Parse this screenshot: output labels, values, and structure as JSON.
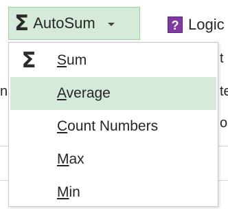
{
  "ribbon": {
    "autosum": {
      "icon": "sigma-icon",
      "glyph": "Σ",
      "label": "AutoSum",
      "caret": "dropdown-caret"
    },
    "logical": {
      "icon": "logical-function-icon",
      "glyph": "?",
      "label": "Logic"
    }
  },
  "background": {
    "frag_n": "n",
    "frag_t": "t",
    "frag_te": "te",
    "frag_on": "on"
  },
  "menu": {
    "items": [
      {
        "accel": "S",
        "rest": "um",
        "glyph": "Σ",
        "active": false
      },
      {
        "accel": "A",
        "rest": "verage",
        "glyph": "",
        "active": true
      },
      {
        "accel": "C",
        "rest": "ount Numbers",
        "glyph": "",
        "active": false
      },
      {
        "accel": "M",
        "rest": "ax",
        "glyph": "",
        "active": false
      },
      {
        "accel": "M",
        "rest": "in",
        "glyph": "",
        "active": false
      }
    ]
  },
  "colors": {
    "highlight": "#d5ead9",
    "button_border": "#9ccfa8",
    "logical_icon": "#7e3aa0"
  }
}
